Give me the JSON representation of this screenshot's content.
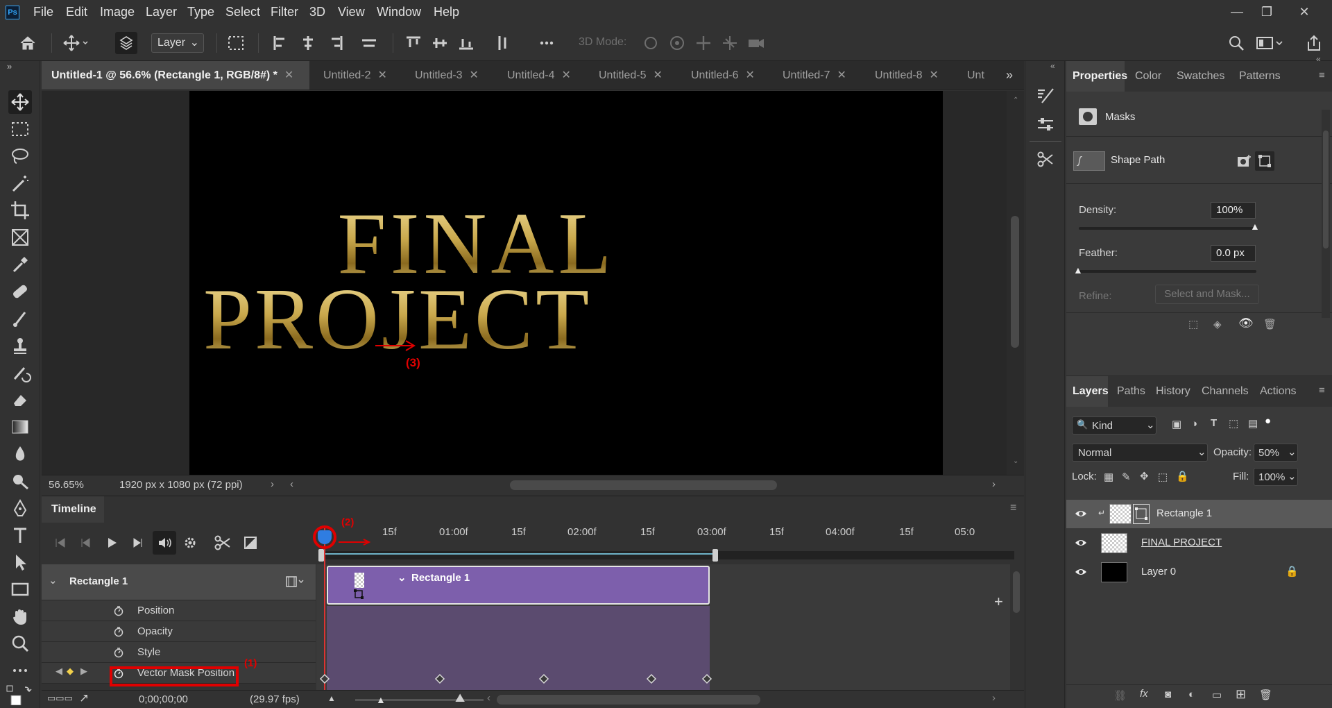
{
  "app": {
    "logo": "Ps",
    "menu": [
      "File",
      "Edit",
      "Image",
      "Layer",
      "Type",
      "Select",
      "Filter",
      "3D",
      "View",
      "Window",
      "Help"
    ]
  },
  "options_bar": {
    "layer_dropdown": "Layer",
    "mode_3d_label": "3D Mode:"
  },
  "doc_tabs": [
    {
      "label": "Untitled-1 @ 56.6% (Rectangle 1, RGB/8#) *",
      "active": true
    },
    {
      "label": "Untitled-2"
    },
    {
      "label": "Untitled-3"
    },
    {
      "label": "Untitled-4"
    },
    {
      "label": "Untitled-5"
    },
    {
      "label": "Untitled-6"
    },
    {
      "label": "Untitled-7"
    },
    {
      "label": "Untitled-8"
    },
    {
      "label": "Unt"
    }
  ],
  "canvas": {
    "line1": "FINAL",
    "line2": "PROJECT",
    "annotation_3": "(3)"
  },
  "status": {
    "zoom": "56.65%",
    "doc_size": "1920 px x 1080 px (72 ppi)"
  },
  "timeline": {
    "tab": "Timeline",
    "ruler": [
      "15f",
      "01:00f",
      "15f",
      "02:00f",
      "15f",
      "03:00f",
      "15f",
      "04:00f",
      "15f",
      "05:0"
    ],
    "track_name": "Rectangle 1",
    "clip_name": "Rectangle 1",
    "properties": [
      "Position",
      "Opacity",
      "Style",
      "Vector Mask Position"
    ],
    "timecode": "0;00;00;00",
    "fps": "(29.97 fps)",
    "annotation_1": "(1)",
    "annotation_2": "(2)"
  },
  "properties_panel": {
    "tabs": [
      "Properties",
      "Color",
      "Swatches",
      "Patterns"
    ],
    "section": "Masks",
    "shape_path": "Shape Path",
    "density_label": "Density:",
    "density_value": "100%",
    "feather_label": "Feather:",
    "feather_value": "0.0 px",
    "refine_label": "Refine:",
    "select_mask_btn": "Select and Mask..."
  },
  "layers_panel": {
    "tabs": [
      "Layers",
      "Paths",
      "History",
      "Channels",
      "Actions"
    ],
    "kind": "Kind",
    "blend_mode": "Normal",
    "opacity_label": "Opacity:",
    "opacity_value": "50%",
    "lock_label": "Lock:",
    "fill_label": "Fill:",
    "fill_value": "100%",
    "layers": [
      {
        "name": "Rectangle 1",
        "selected": true
      },
      {
        "name": "FINAL PROJECT"
      },
      {
        "name": "Layer 0"
      }
    ]
  },
  "colors": {
    "accent_clip": "#7d5fac",
    "annotation_red": "#e00000",
    "playhead_blue": "#2f7de1",
    "gold": "#c9a84c"
  }
}
